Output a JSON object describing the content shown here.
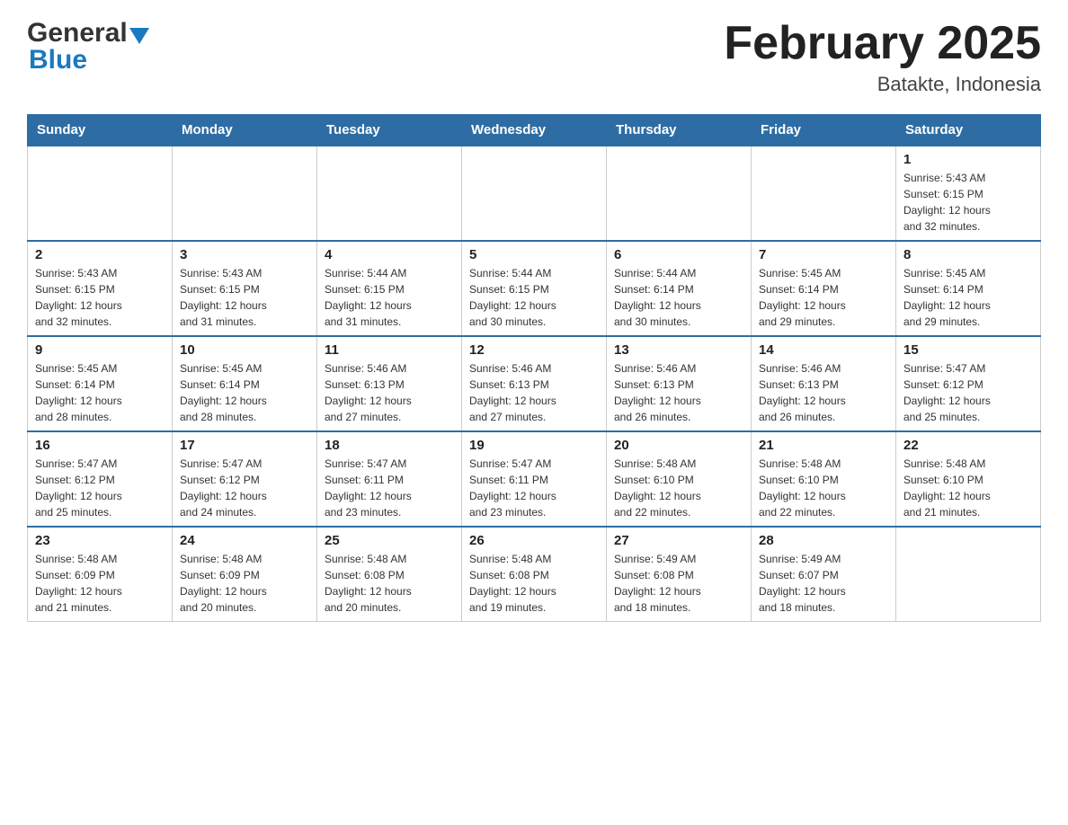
{
  "logo": {
    "general": "General",
    "blue": "Blue"
  },
  "title": "February 2025",
  "location": "Batakte, Indonesia",
  "days_header": [
    "Sunday",
    "Monday",
    "Tuesday",
    "Wednesday",
    "Thursday",
    "Friday",
    "Saturday"
  ],
  "weeks": [
    [
      {
        "day": "",
        "info": ""
      },
      {
        "day": "",
        "info": ""
      },
      {
        "day": "",
        "info": ""
      },
      {
        "day": "",
        "info": ""
      },
      {
        "day": "",
        "info": ""
      },
      {
        "day": "",
        "info": ""
      },
      {
        "day": "1",
        "info": "Sunrise: 5:43 AM\nSunset: 6:15 PM\nDaylight: 12 hours\nand 32 minutes."
      }
    ],
    [
      {
        "day": "2",
        "info": "Sunrise: 5:43 AM\nSunset: 6:15 PM\nDaylight: 12 hours\nand 32 minutes."
      },
      {
        "day": "3",
        "info": "Sunrise: 5:43 AM\nSunset: 6:15 PM\nDaylight: 12 hours\nand 31 minutes."
      },
      {
        "day": "4",
        "info": "Sunrise: 5:44 AM\nSunset: 6:15 PM\nDaylight: 12 hours\nand 31 minutes."
      },
      {
        "day": "5",
        "info": "Sunrise: 5:44 AM\nSunset: 6:15 PM\nDaylight: 12 hours\nand 30 minutes."
      },
      {
        "day": "6",
        "info": "Sunrise: 5:44 AM\nSunset: 6:14 PM\nDaylight: 12 hours\nand 30 minutes."
      },
      {
        "day": "7",
        "info": "Sunrise: 5:45 AM\nSunset: 6:14 PM\nDaylight: 12 hours\nand 29 minutes."
      },
      {
        "day": "8",
        "info": "Sunrise: 5:45 AM\nSunset: 6:14 PM\nDaylight: 12 hours\nand 29 minutes."
      }
    ],
    [
      {
        "day": "9",
        "info": "Sunrise: 5:45 AM\nSunset: 6:14 PM\nDaylight: 12 hours\nand 28 minutes."
      },
      {
        "day": "10",
        "info": "Sunrise: 5:45 AM\nSunset: 6:14 PM\nDaylight: 12 hours\nand 28 minutes."
      },
      {
        "day": "11",
        "info": "Sunrise: 5:46 AM\nSunset: 6:13 PM\nDaylight: 12 hours\nand 27 minutes."
      },
      {
        "day": "12",
        "info": "Sunrise: 5:46 AM\nSunset: 6:13 PM\nDaylight: 12 hours\nand 27 minutes."
      },
      {
        "day": "13",
        "info": "Sunrise: 5:46 AM\nSunset: 6:13 PM\nDaylight: 12 hours\nand 26 minutes."
      },
      {
        "day": "14",
        "info": "Sunrise: 5:46 AM\nSunset: 6:13 PM\nDaylight: 12 hours\nand 26 minutes."
      },
      {
        "day": "15",
        "info": "Sunrise: 5:47 AM\nSunset: 6:12 PM\nDaylight: 12 hours\nand 25 minutes."
      }
    ],
    [
      {
        "day": "16",
        "info": "Sunrise: 5:47 AM\nSunset: 6:12 PM\nDaylight: 12 hours\nand 25 minutes."
      },
      {
        "day": "17",
        "info": "Sunrise: 5:47 AM\nSunset: 6:12 PM\nDaylight: 12 hours\nand 24 minutes."
      },
      {
        "day": "18",
        "info": "Sunrise: 5:47 AM\nSunset: 6:11 PM\nDaylight: 12 hours\nand 23 minutes."
      },
      {
        "day": "19",
        "info": "Sunrise: 5:47 AM\nSunset: 6:11 PM\nDaylight: 12 hours\nand 23 minutes."
      },
      {
        "day": "20",
        "info": "Sunrise: 5:48 AM\nSunset: 6:10 PM\nDaylight: 12 hours\nand 22 minutes."
      },
      {
        "day": "21",
        "info": "Sunrise: 5:48 AM\nSunset: 6:10 PM\nDaylight: 12 hours\nand 22 minutes."
      },
      {
        "day": "22",
        "info": "Sunrise: 5:48 AM\nSunset: 6:10 PM\nDaylight: 12 hours\nand 21 minutes."
      }
    ],
    [
      {
        "day": "23",
        "info": "Sunrise: 5:48 AM\nSunset: 6:09 PM\nDaylight: 12 hours\nand 21 minutes."
      },
      {
        "day": "24",
        "info": "Sunrise: 5:48 AM\nSunset: 6:09 PM\nDaylight: 12 hours\nand 20 minutes."
      },
      {
        "day": "25",
        "info": "Sunrise: 5:48 AM\nSunset: 6:08 PM\nDaylight: 12 hours\nand 20 minutes."
      },
      {
        "day": "26",
        "info": "Sunrise: 5:48 AM\nSunset: 6:08 PM\nDaylight: 12 hours\nand 19 minutes."
      },
      {
        "day": "27",
        "info": "Sunrise: 5:49 AM\nSunset: 6:08 PM\nDaylight: 12 hours\nand 18 minutes."
      },
      {
        "day": "28",
        "info": "Sunrise: 5:49 AM\nSunset: 6:07 PM\nDaylight: 12 hours\nand 18 minutes."
      },
      {
        "day": "",
        "info": ""
      }
    ]
  ]
}
